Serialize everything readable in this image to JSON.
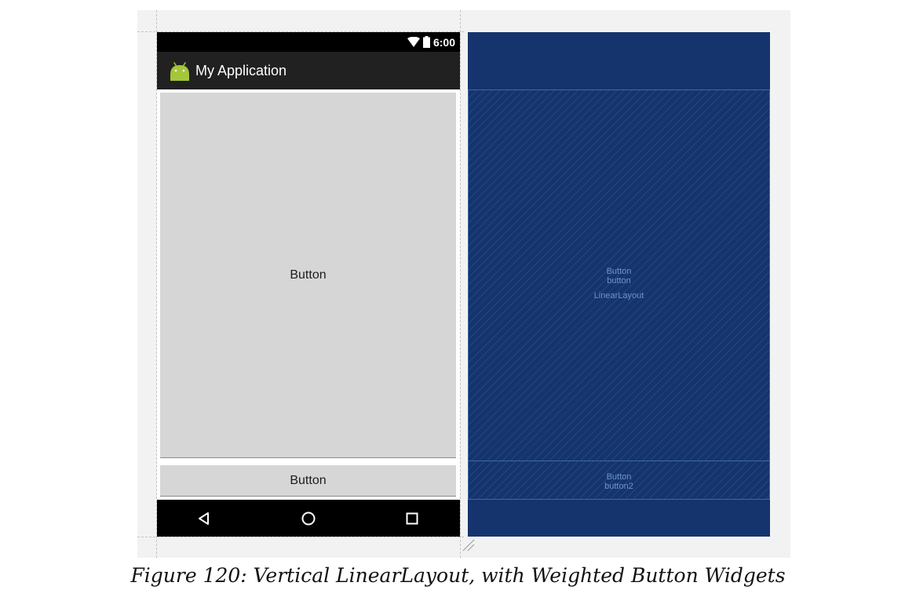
{
  "status_bar": {
    "time": "6:00",
    "icons": [
      "wifi-icon",
      "battery-icon"
    ]
  },
  "app_bar": {
    "title": "My Application",
    "icon": "android-icon"
  },
  "layout": {
    "buttons": [
      {
        "label": "Button"
      },
      {
        "label": "Button"
      }
    ]
  },
  "nav_bar": {
    "icons": [
      "back-icon",
      "home-icon",
      "recents-icon"
    ]
  },
  "blueprint": {
    "regions": [
      {
        "type": "Button",
        "id": "button",
        "parent": "LinearLayout"
      },
      {
        "type": "Button",
        "id": "button2"
      }
    ]
  },
  "caption": "Figure 120: Vertical LinearLayout, with Weighted Button Widgets",
  "colors": {
    "status_bar": "#000000",
    "app_bar": "#212121",
    "button": "#d6d6d6",
    "blueprint": "#15346d",
    "blueprint_line": "#3e67a8"
  }
}
